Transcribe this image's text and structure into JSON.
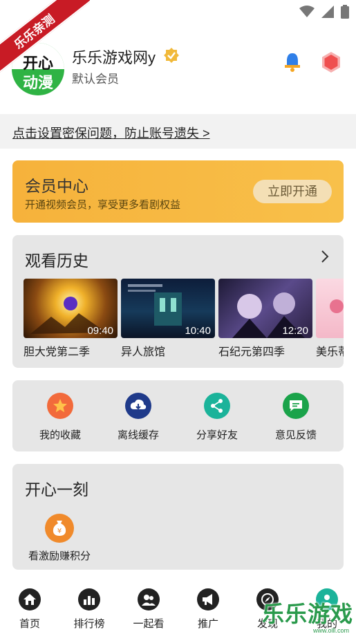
{
  "ribbon": "乐乐亲测",
  "profile": {
    "avatar_line1": "开心",
    "avatar_line2": "动漫",
    "username": "乐乐游戏网y",
    "role": "默认会员"
  },
  "notice": "点击设置密保问题，防止账号遗失 >",
  "member": {
    "title": "会员中心",
    "subtitle": "开通视频会员，享受更多看剧权益",
    "button": "立即开通"
  },
  "history": {
    "title": "观看历史",
    "items": [
      {
        "name": "胆大党第二季",
        "duration": "09:40"
      },
      {
        "name": "异人旅馆",
        "duration": "10:40"
      },
      {
        "name": "石纪元第四季",
        "duration": "12:20"
      },
      {
        "name": "美乐蒂",
        "duration": ""
      }
    ]
  },
  "actions": [
    {
      "label": "我的收藏",
      "icon": "star-icon",
      "color": "#f26a3b"
    },
    {
      "label": "离线缓存",
      "icon": "cloud-download-icon",
      "color": "#1f3a8a"
    },
    {
      "label": "分享好友",
      "icon": "share-icon",
      "color": "#1bb39a"
    },
    {
      "label": "意见反馈",
      "icon": "message-icon",
      "color": "#1aa34a"
    }
  ],
  "moment": {
    "title": "开心一刻",
    "item_label": "看激励赚积分",
    "item_icon": "money-bag-icon"
  },
  "nav": [
    {
      "label": "首页",
      "icon": "home-icon"
    },
    {
      "label": "排行榜",
      "icon": "ranking-icon"
    },
    {
      "label": "一起看",
      "icon": "group-icon"
    },
    {
      "label": "推广",
      "icon": "megaphone-icon"
    },
    {
      "label": "发现",
      "icon": "compass-icon"
    },
    {
      "label": "我的",
      "icon": "profile-icon"
    }
  ],
  "watermark": {
    "text": "乐乐游戏",
    "sub": "www.olll.com"
  },
  "colors": {
    "member_gold": "#f6b23b",
    "card_gray": "#e6e6e6",
    "bell_blue": "#2f7fe8",
    "hex_red": "#ef4f4f"
  }
}
